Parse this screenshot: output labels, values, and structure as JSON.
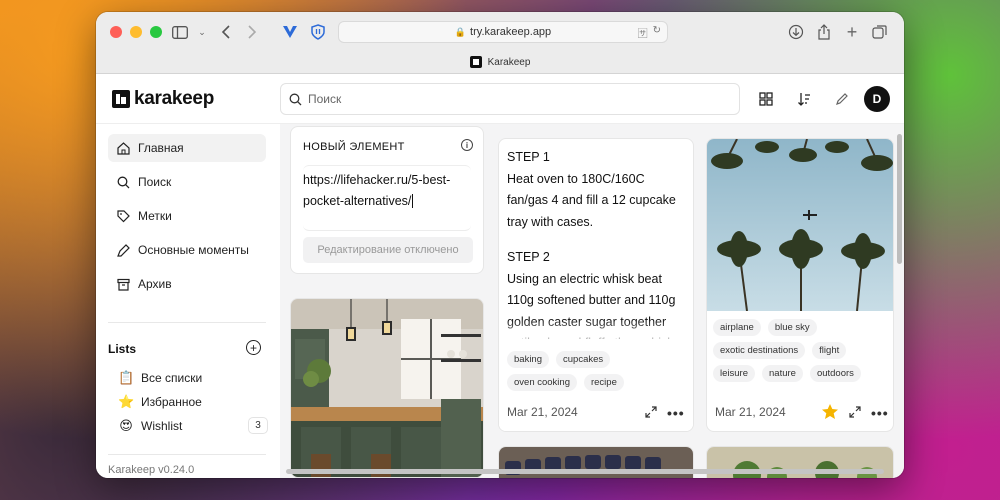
{
  "browser": {
    "url": "try.karakeep.app",
    "tab_title": "Karakeep"
  },
  "app": {
    "logo_text": "karakeep",
    "search_placeholder": "Поиск",
    "avatar_initial": "D"
  },
  "sidebar": {
    "nav": [
      {
        "label": "Главная",
        "icon": "home-icon",
        "active": true
      },
      {
        "label": "Поиск",
        "icon": "search-icon"
      },
      {
        "label": "Метки",
        "icon": "tag-icon"
      },
      {
        "label": "Основные моменты",
        "icon": "highlighter-icon"
      },
      {
        "label": "Архив",
        "icon": "archive-icon"
      }
    ],
    "lists_title": "Lists",
    "lists": [
      {
        "emoji": "📋",
        "label": "Все списки"
      },
      {
        "emoji": "⭐",
        "label": "Избранное"
      },
      {
        "emoji": "😍",
        "label": "Wishlist",
        "count": "3"
      }
    ],
    "version": "Karakeep v0.24.0"
  },
  "cards": {
    "new_item": {
      "title": "НОВЫЙ ЭЛЕМЕНТ",
      "text": "https://lifehacker.ru/5-best-pocket-alternatives/",
      "disabled_label": "Редактирование отключено"
    },
    "recipe": {
      "step1_title": "STEP 1",
      "step1_text": "Heat oven to 180C/160C fan/gas 4 and fill a 12 cupcake tray with cases.",
      "step2_title": "STEP 2",
      "step2_text": "Using an electric whisk beat 110g softened butter and 110g golden caster sugar together until pale and fluffy then whisk",
      "tags": [
        "baking",
        "cupcakes",
        "oven cooking",
        "recipe"
      ],
      "date": "Mar 21, 2024"
    },
    "palms": {
      "tags": [
        "airplane",
        "blue sky",
        "exotic destinations",
        "flight",
        "leisure",
        "nature",
        "outdoors"
      ],
      "date": "Mar 21, 2024"
    }
  },
  "colors": {
    "accent": "#111111",
    "star": "#f5b400"
  }
}
